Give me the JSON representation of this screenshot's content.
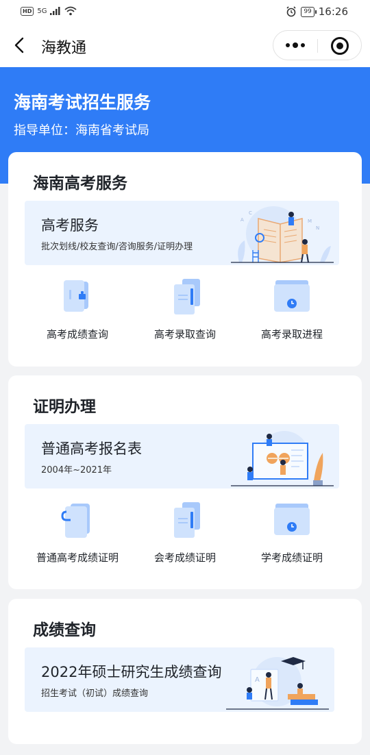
{
  "status_bar": {
    "hd": "HD",
    "signal": "5G",
    "battery": "99",
    "time": "16:26"
  },
  "nav": {
    "title": "海教通"
  },
  "hero": {
    "title": "海南考试招生服务",
    "subtitle": "指导单位：海南省考试局"
  },
  "sections": [
    {
      "title": "海南高考服务",
      "banner": {
        "title": "高考服务",
        "subtitle": "批次划线/校友查询/咨询服务/证明办理"
      },
      "items": [
        {
          "label": "高考成绩查询",
          "icon": "score-doc-icon"
        },
        {
          "label": "高考录取查询",
          "icon": "admission-doc-icon"
        },
        {
          "label": "高考录取进程",
          "icon": "folder-clock-icon"
        }
      ]
    },
    {
      "title": "证明办理",
      "banner": {
        "title": "普通高考报名表",
        "subtitle": "2004年~2021年"
      },
      "items": [
        {
          "label": "普通高考成绩证明",
          "icon": "clip-doc-icon"
        },
        {
          "label": "会考成绩证明",
          "icon": "certificate-doc-icon"
        },
        {
          "label": "学考成绩证明",
          "icon": "folder-clock-icon"
        }
      ]
    },
    {
      "title": "成绩查询",
      "banner": {
        "title": "2022年硕士研究生成绩查询",
        "subtitle": "招生考试（初试）成绩查询"
      }
    }
  ],
  "colors": {
    "brand": "#2f7cf6",
    "banner_bg": "#ebf3fe",
    "icon_light": "#cfe2fd",
    "icon_mid": "#a8c9fb",
    "icon_dark": "#2f7cf6"
  }
}
